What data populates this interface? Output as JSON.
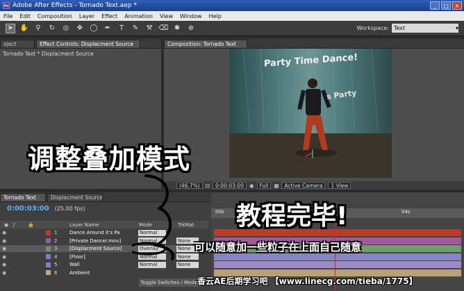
{
  "window": {
    "title": "Adobe After Effects - Tornado Text.aep *"
  },
  "menu": [
    "File",
    "Edit",
    "Composition",
    "Layer",
    "Effect",
    "Animation",
    "View",
    "Window",
    "Help"
  ],
  "workspace": {
    "label": "Workspace:",
    "value": "Text"
  },
  "left_panel": {
    "tabs": [
      "oject",
      "Effect Controls: Displacment Source"
    ],
    "subtitle": "Tornado Text * Displacment Source"
  },
  "comp_panel": {
    "tab": "Composition: Tornado Text",
    "viewer_text_1": "Party Time Dance!",
    "viewer_text_2": "s Party",
    "zoom": "(46.7%)",
    "time": "0:00:03:00",
    "resolution": "Full",
    "camera": "Active Camera",
    "views": "1 View"
  },
  "timeline": {
    "tabs": [
      "Tornado Text",
      "Displacment Source"
    ],
    "timecode": "0:00:03:00",
    "fps": "(25.00 fps)",
    "col_layer_name": "Layer Name",
    "col_mode": "Mode",
    "col_trkmat": "TrkMat",
    "ruler": [
      "00s",
      "04s"
    ],
    "toggle_label": "Toggle Switches / Modes",
    "layers": [
      {
        "num": "1",
        "name": "Dance Around it's Pa",
        "mode": "Normal",
        "trkmat": "",
        "color": "#c0392b"
      },
      {
        "num": "2",
        "name": "[Private Dancer.mov]",
        "mode": "Normal",
        "trkmat": "None",
        "color": "#8e5fb0"
      },
      {
        "num": "3",
        "name": "[Displacment Source]",
        "mode": "Overlay",
        "trkmat": "None",
        "color": "#6f8f6f"
      },
      {
        "num": "4",
        "name": "[Floor]",
        "mode": "Normal",
        "trkmat": "None",
        "color": "#7f7fd0"
      },
      {
        "num": "5",
        "name": "Wall",
        "mode": "Normal",
        "trkmat": "None",
        "color": "#8a7ad8"
      },
      {
        "num": "6",
        "name": "Ambient",
        "mode": "",
        "trkmat": "",
        "color": "#c9a978"
      }
    ],
    "bar_colors": [
      "#c0392b",
      "#a05a9a",
      "#6f9f6f",
      "#8585c8",
      "#9e88c8",
      "#b9a078"
    ]
  },
  "captions": {
    "main": "调整叠加模式",
    "done": "教程完毕!",
    "sub": "可以随意加一些粒子在上面自己随意",
    "footer": "香云AE后期学习吧 【www.linecg.com/tieba/1775】"
  }
}
